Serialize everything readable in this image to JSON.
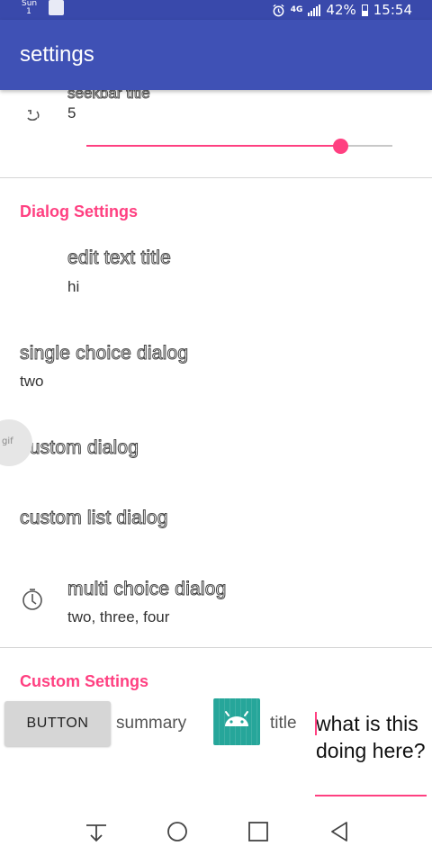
{
  "status_bar": {
    "day": "Sun",
    "date": "1",
    "network": "4G",
    "battery": "42%",
    "time": "15:54"
  },
  "app_bar": {
    "title": "settings"
  },
  "slider_pref": {
    "partial_title": "seekbar title",
    "value": "5",
    "fill_fraction": 0.83
  },
  "dialog_section": {
    "header": "Dialog Settings",
    "rows": [
      {
        "title": "edit text title",
        "summary": "hi"
      },
      {
        "title": "single choice dialog",
        "summary": "two"
      },
      {
        "title": "custom dialog"
      },
      {
        "title": "custom list dialog"
      },
      {
        "title": "multi choice dialog",
        "summary": "two, three, four"
      }
    ]
  },
  "gif_tab": {
    "label": "gif"
  },
  "custom_section": {
    "header": "Custom Settings",
    "button_label": "BUTTON",
    "summary": "summary",
    "title": "title",
    "edit_text": "what is this doing here?"
  },
  "colors": {
    "primary": "#3f51b5",
    "primary_dark": "#3949ab",
    "accent": "#ff4081",
    "android_tile": "#26a69a"
  },
  "icons": [
    "alarm-icon",
    "signal-icon",
    "battery-icon",
    "timer-icon",
    "android-icon",
    "download-icon",
    "home-icon",
    "recents-icon",
    "back-icon"
  ]
}
